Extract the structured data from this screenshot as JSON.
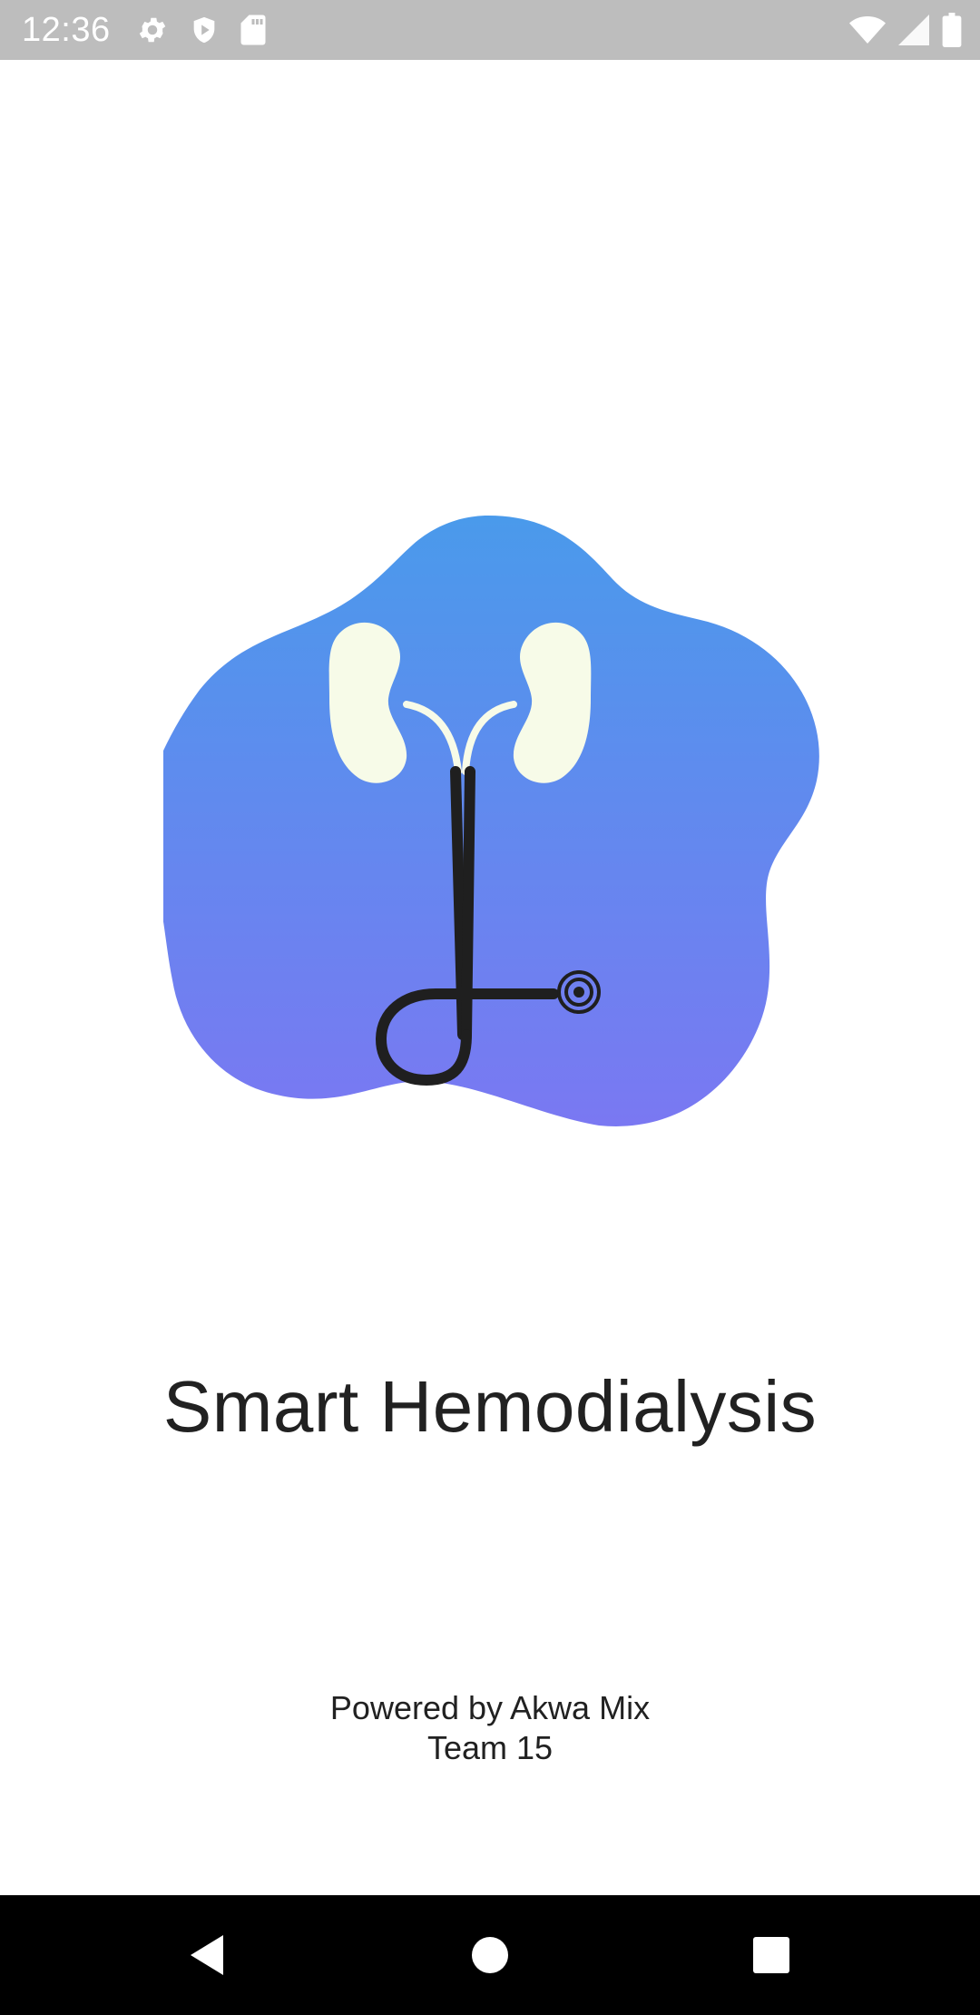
{
  "status_bar": {
    "time": "12:36",
    "left_icons": [
      "gear-icon",
      "shield-icon",
      "sd-card-icon"
    ],
    "right_icons": [
      "wifi-icon",
      "cellular-signal-icon",
      "battery-icon"
    ]
  },
  "splash": {
    "logo_icon": "kidney-stethoscope-logo-icon",
    "logo_gradient": [
      "#4a9aeb",
      "#7a78f2"
    ],
    "title": "Smart Hemodialysis",
    "powered_line1": "Powered by Akwa Mix",
    "powered_line2": "Team 15"
  },
  "nav_bar": {
    "buttons": [
      "back-icon",
      "home-icon",
      "recents-icon"
    ]
  }
}
